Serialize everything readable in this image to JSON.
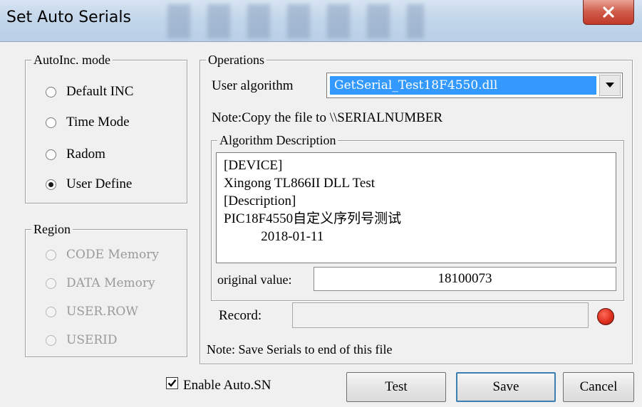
{
  "window": {
    "title": "Set Auto Serials"
  },
  "autoinc": {
    "legend": "AutoInc. mode",
    "options": [
      {
        "label": "Default INC",
        "checked": false
      },
      {
        "label": "Time Mode",
        "checked": false
      },
      {
        "label": "Radom",
        "checked": false
      },
      {
        "label": "User Define",
        "checked": true
      }
    ]
  },
  "region": {
    "legend": "Region",
    "options": [
      {
        "label": "CODE Memory"
      },
      {
        "label": "DATA Memory"
      },
      {
        "label": "USER.ROW"
      },
      {
        "label": "USERID"
      }
    ]
  },
  "operations": {
    "legend": "Operations",
    "user_algorithm_label": "User algorithm",
    "user_algorithm_value": "GetSerial_Test18F4550.dll",
    "note_copy": "Note:Copy the file to \\\\SERIALNUMBER",
    "algo_desc_legend": "Algorithm Description",
    "algo_desc_lines": [
      "[DEVICE]",
      "Xingong TL866II DLL Test",
      "[Description]",
      "PIC18F4550自定义序列号测试",
      "           2018-01-11"
    ],
    "original_value_label": "original value:",
    "original_value": "18100073",
    "record_label": "Record:",
    "record_value": "",
    "note_save": "Note: Save Serials to end of this file"
  },
  "footer": {
    "enable_auto_sn_label": "Enable Auto.SN",
    "enable_auto_sn_checked": true,
    "test_label": "Test",
    "save_label": "Save",
    "cancel_label": "Cancel"
  },
  "colors": {
    "selection": "#3399ff",
    "record_dot": "#e0301e",
    "close_button": "#c0392b"
  }
}
